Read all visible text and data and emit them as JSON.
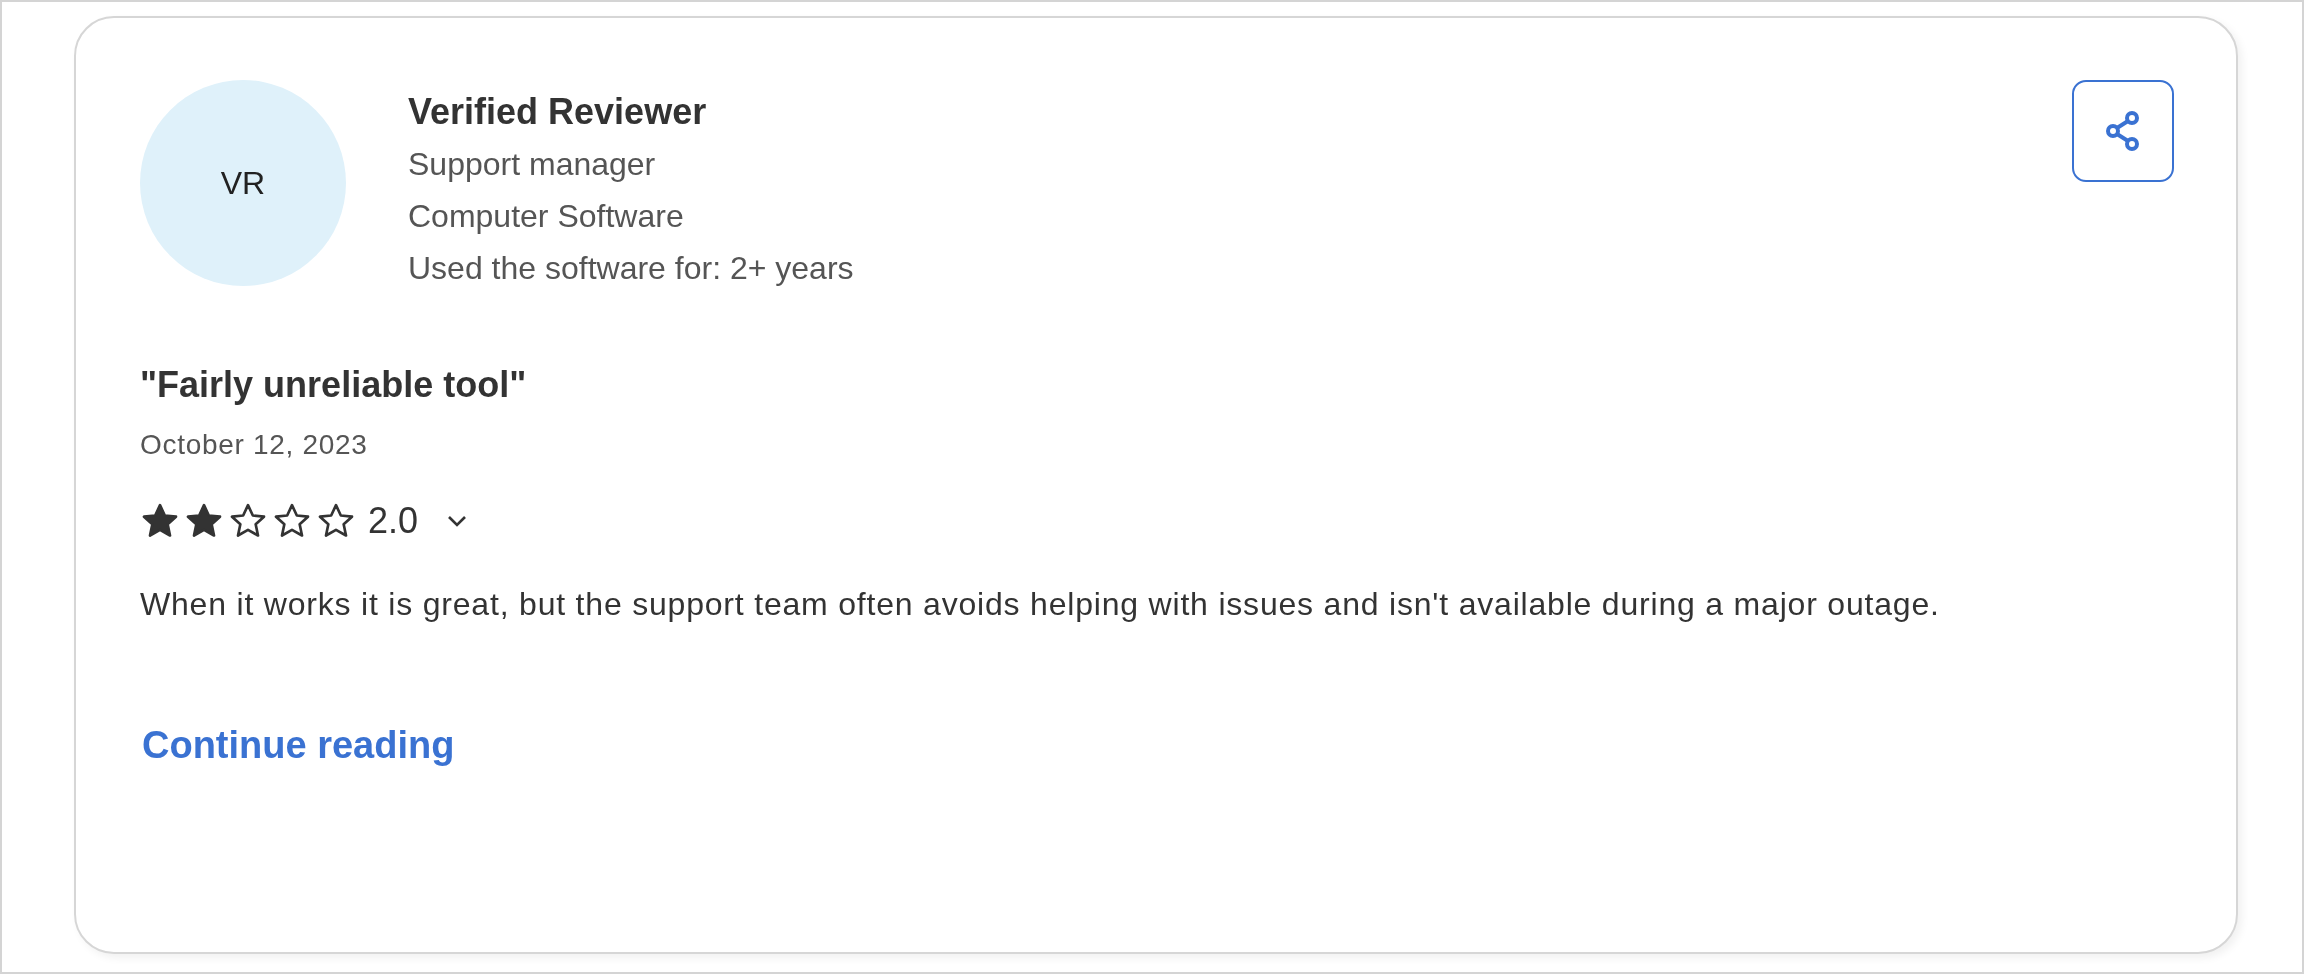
{
  "reviewer": {
    "initials": "VR",
    "name": "Verified Reviewer",
    "details": [
      "Support manager",
      "Computer Software",
      "Used the software for: 2+ years"
    ]
  },
  "review": {
    "title": "\"Fairly unreliable tool\"",
    "date": "October 12, 2023",
    "stars": 2,
    "rating": "2.0",
    "expanded": false,
    "body": "When it works it is great, but the support team often avoids helping with issues and isn't available during a major outage.",
    "link": "Continue reading"
  }
}
